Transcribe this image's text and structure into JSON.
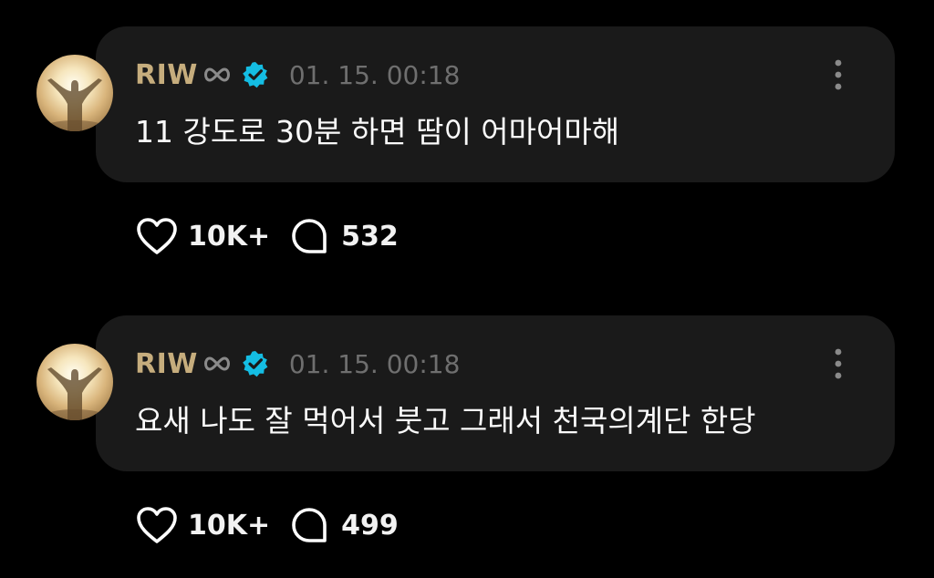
{
  "posts": [
    {
      "username": "RIW",
      "timestamp": "01. 15. 00:18",
      "text": "11 강도로 30분 하면 땀이 어마어마해",
      "likes": "10K+",
      "comments": "532"
    },
    {
      "username": "RIW",
      "timestamp": "01. 15. 00:18",
      "text": "요새 나도 잘 먹어서 붓고 그래서 천국의계단 한당",
      "likes": "10K+",
      "comments": "499"
    }
  ],
  "colors": {
    "background": "#000000",
    "bubble": "#1a1a1a",
    "username": "#c6ad7d",
    "verified": "#14bde3",
    "timestamp": "#6f6f6f",
    "text": "#fafafa"
  },
  "icons": [
    "infinity-icon",
    "verified-badge-icon",
    "more-options-icon",
    "heart-icon",
    "comment-icon"
  ]
}
